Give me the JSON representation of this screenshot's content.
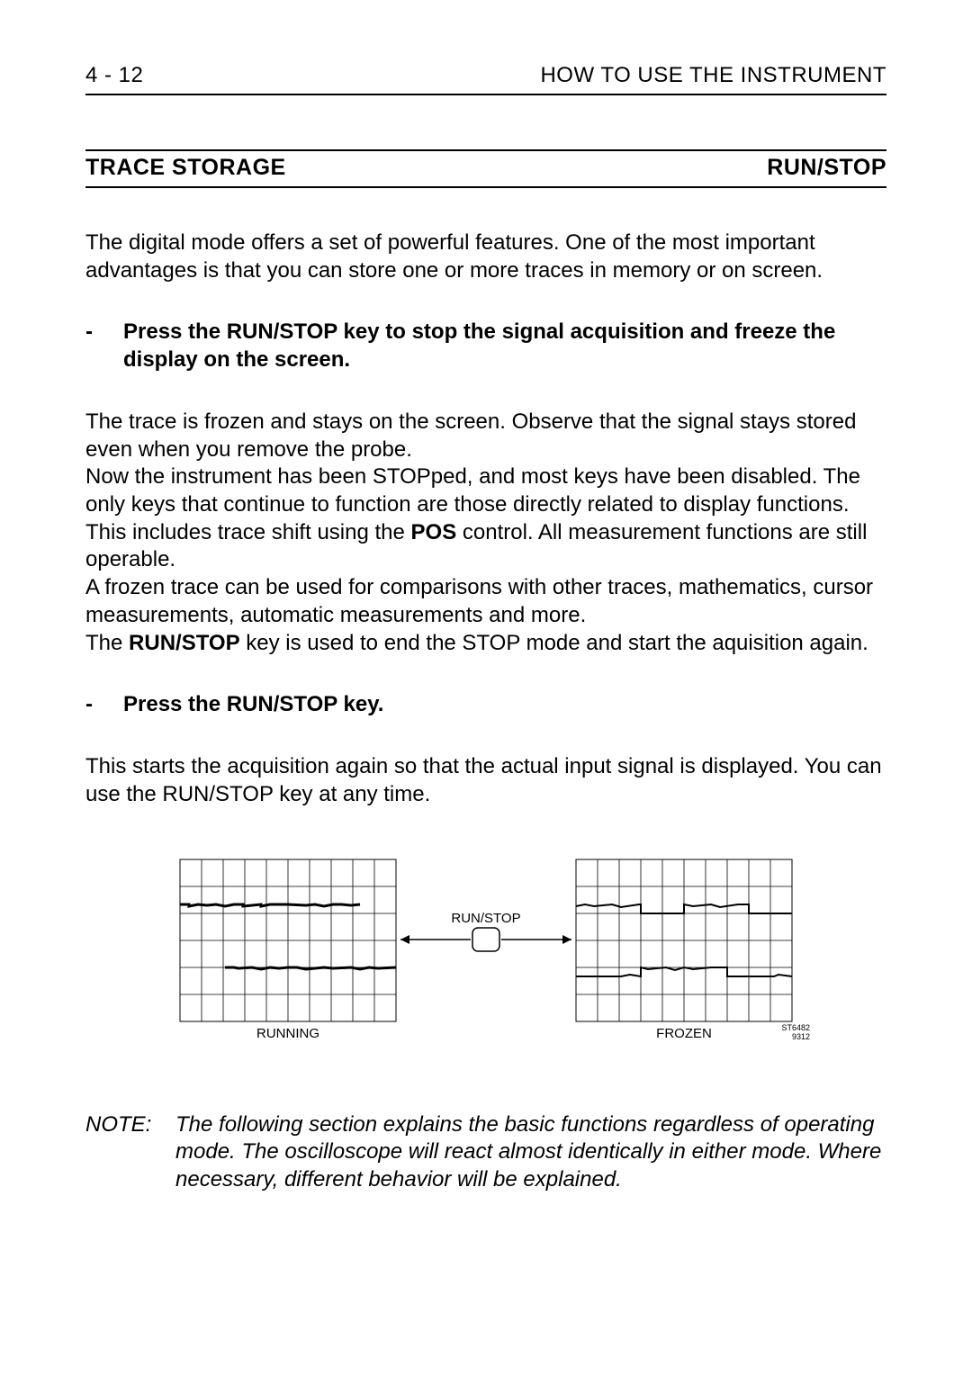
{
  "header": {
    "page_num": "4 - 12",
    "chapter": "HOW TO USE THE INSTRUMENT"
  },
  "section": {
    "title_left": "TRACE STORAGE",
    "title_right": "RUN/STOP"
  },
  "para1": "The digital mode offers a set of powerful features. One of the most important advantages is that you can store one or more traces in memory or on screen.",
  "instr1": {
    "dash": "-",
    "text_pre": "Press the RUN/STOP key to stop the signal acquisition and freeze the display on the screen."
  },
  "para2a": "The trace is frozen and stays on the screen. Observe that the signal stays stored even when you remove the probe.",
  "para2b_pre": "Now the instrument has been STOPped, and most keys have been disabled. The only keys that continue to function are those directly related to display functions. This includes trace shift using the ",
  "para2b_bold": "POS",
  "para2b_post": " control. All measurement functions are still operable.",
  "para2c": "A frozen trace can be used for comparisons with other traces, mathematics, cursor measurements, automatic measurements and more.",
  "para2d_pre": "The ",
  "para2d_bold": "RUN/STOP",
  "para2d_post": " key is used to end the STOP mode and start the aquisition again.",
  "instr2": {
    "dash": "-",
    "text": "Press the RUN/STOP key."
  },
  "para3": "This starts the acquisition again so that the actual input signal is displayed. You can use the RUN/STOP key at any time.",
  "figure": {
    "left_caption": "RUNNING",
    "right_caption": "FROZEN",
    "center_label": "RUN/STOP",
    "fig_id1": "ST6482",
    "fig_id2": "9312"
  },
  "note": {
    "label": "NOTE:",
    "text": "The following section explains the basic functions regardless of operating mode. The oscilloscope will react almost identically in either mode. Where necessary, different behavior will be explained."
  }
}
